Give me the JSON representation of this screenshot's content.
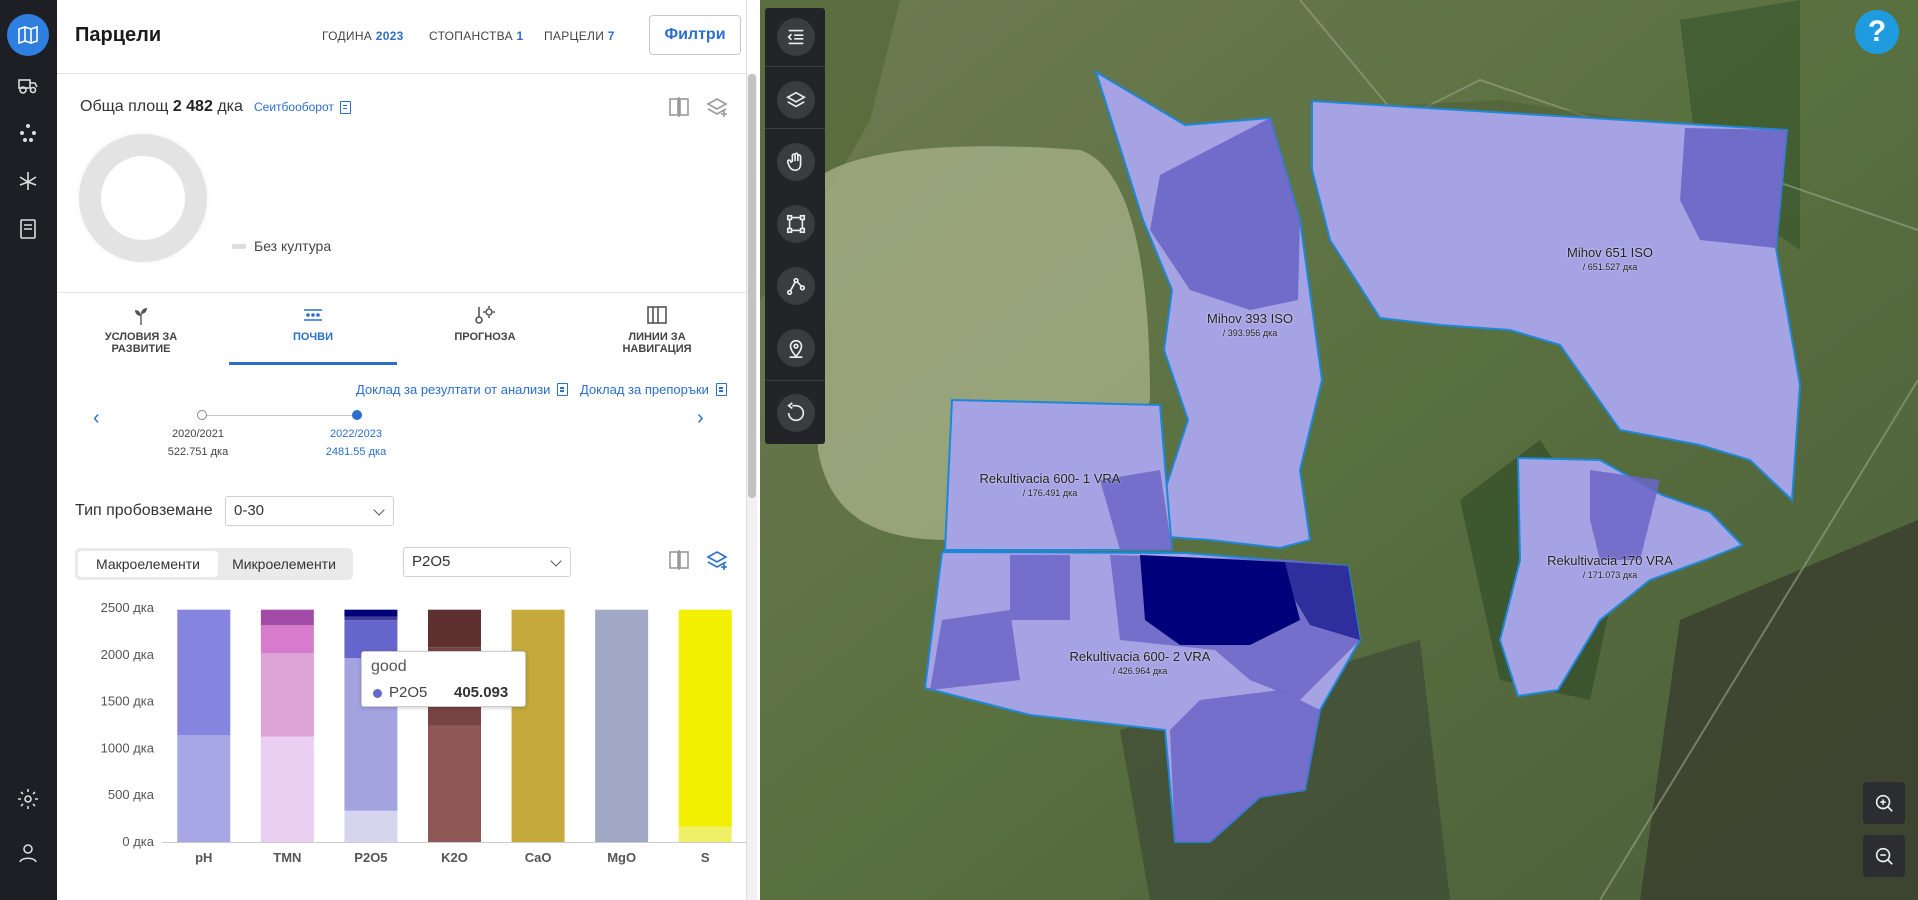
{
  "header": {
    "title": "Парцели",
    "stats": [
      {
        "label": "ГОДИНА",
        "value": "2023"
      },
      {
        "label": "СТОПАНСТВА",
        "value": "1"
      },
      {
        "label": "ПАРЦЕЛИ",
        "value": "7"
      }
    ],
    "filters_label": "Филтри"
  },
  "summary": {
    "area_prefix": "Обща площ",
    "area_value": "2 482",
    "area_unit": "дка",
    "rotation_link": "Сеитбооборот",
    "legend_none": "Без култура"
  },
  "tabs": [
    {
      "label": "УСЛОВИЯ ЗА РАЗВИТИЕ",
      "icon": "sprout-icon",
      "active": false
    },
    {
      "label": "ПОЧВИ",
      "icon": "soil-icon",
      "active": true
    },
    {
      "label": "ПРОГНОЗА",
      "icon": "weather-forecast-icon",
      "active": false
    },
    {
      "label": "ЛИНИИ ЗА НАВИГАЦИЯ",
      "icon": "navigation-lines-icon",
      "active": false
    }
  ],
  "reports": {
    "analysis_results": "Доклад за резултати от анализи",
    "recommendations": "Доклад за препоръки"
  },
  "timeline": [
    {
      "season": "2020/2021",
      "area": "522.751 дка",
      "active": false
    },
    {
      "season": "2022/2023",
      "area": "2481.55 дка",
      "active": true
    }
  ],
  "sampling": {
    "label": "Тип пробовземане",
    "value": "0-30"
  },
  "element_toggle": {
    "macro": "Макроелементи",
    "micro": "Микроелементи",
    "active": "macro"
  },
  "element_select": {
    "value": "P2O5"
  },
  "chart_data": {
    "type": "bar",
    "stacked": true,
    "categories": [
      "pH",
      "TMN",
      "P2O5",
      "K2O",
      "CaO",
      "MgO",
      "S"
    ],
    "y_ticks": [
      "0 дка",
      "500 дка",
      "1000 дка",
      "1500 дка",
      "2000 дка",
      "2500 дка"
    ],
    "ylim": [
      0,
      2500
    ],
    "stacks": [
      {
        "category": "pH",
        "segments": [
          {
            "value": 1140,
            "color": "#a6a6e4"
          },
          {
            "value": 1342,
            "color": "#8585df"
          }
        ]
      },
      {
        "category": "TMN",
        "segments": [
          {
            "value": 1125,
            "color": "#ebcff2"
          },
          {
            "value": 890,
            "color": "#dda5d6"
          },
          {
            "value": 300,
            "color": "#d77ccd"
          },
          {
            "value": 167,
            "color": "#a34aa7"
          }
        ]
      },
      {
        "category": "P2O5",
        "segments": [
          {
            "value": 335,
            "color": "#d5d5f0"
          },
          {
            "value": 1630,
            "color": "#a3a3e0"
          },
          {
            "value": 405.093,
            "color": "#6666cc"
          },
          {
            "value": 37,
            "color": "#3d3d99"
          },
          {
            "value": 75,
            "color": "#00007a"
          }
        ]
      },
      {
        "category": "K2O",
        "segments": [
          {
            "value": 1245,
            "color": "#8f5656"
          },
          {
            "value": 837,
            "color": "#774444"
          },
          {
            "value": 400,
            "color": "#5e3030"
          }
        ]
      },
      {
        "category": "CaO",
        "segments": [
          {
            "value": 2482,
            "color": "#c5a93c"
          }
        ]
      },
      {
        "category": "MgO",
        "segments": [
          {
            "value": 2482,
            "color": "#a0a8c6"
          }
        ]
      },
      {
        "category": "S",
        "segments": [
          {
            "value": 165,
            "color": "#f0f066"
          },
          {
            "value": 2317,
            "color": "#f3ef00"
          }
        ]
      }
    ]
  },
  "tooltip": {
    "title": "good",
    "series": "P2O5",
    "value": "405.093"
  },
  "map": {
    "fields": [
      {
        "name": "Mihov 651 ISO",
        "area": "/ 651.527 дка"
      },
      {
        "name": "Mihov 393 ISO",
        "area": "/ 393.956 дка"
      },
      {
        "name": "Rekultivacia 600- 1 VRA",
        "area": "/ 176.491 дка"
      },
      {
        "name": "Rekultivacia 170 VRA",
        "area": "/ 171.073 дка"
      },
      {
        "name": "Rekultivacia 600- 2 VRA",
        "area": "/ 426.964 дка"
      }
    ],
    "help": "?"
  }
}
